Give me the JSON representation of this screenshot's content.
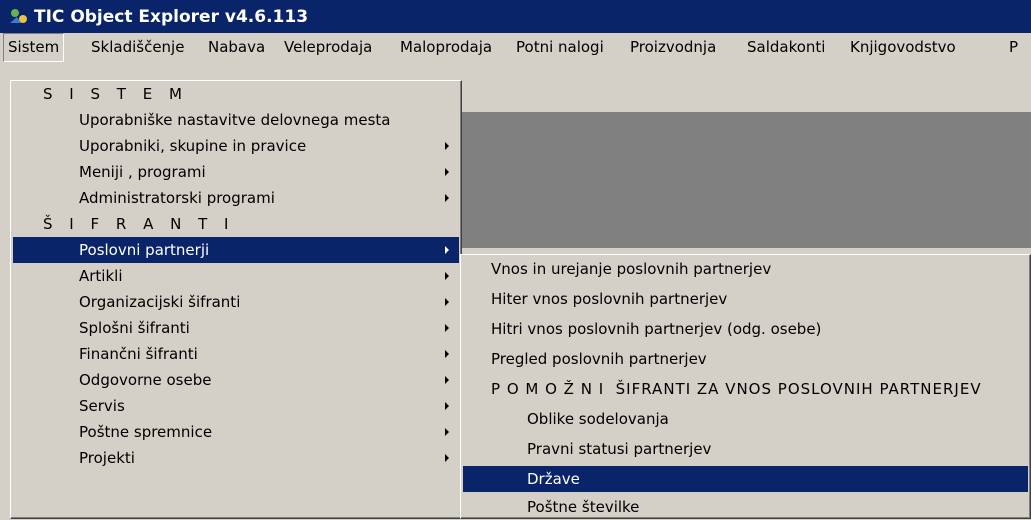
{
  "window": {
    "title": "TIC Object Explorer v4.6.113"
  },
  "menubar": [
    "Sistem",
    "Skladiščenje",
    "Nabava",
    "Veleprodaja",
    "Maloprodaja",
    "Potni nalogi",
    "Proizvodnja",
    "Saldakonti",
    "Knjigovodstvo",
    "P"
  ],
  "sistem_menu": {
    "header_sistem": "S I S T E M",
    "items_sistem": [
      "Uporabniške nastavitve delovnega mesta",
      "Uporabniki, skupine in pravice",
      "Meniji , programi",
      "Administratorski programi"
    ],
    "header_sifranti": "Š I F R A N T I",
    "items_sifranti": [
      "Poslovni partnerji",
      "Artikli",
      "Organizacijski šifranti",
      "Splošni šifranti",
      "Finančni šifranti",
      "Odgovorne osebe",
      "Servis",
      "Poštne spremnice",
      "Projekti"
    ]
  },
  "partner_submenu": {
    "items": [
      "Vnos in urejanje poslovnih partnerjev",
      "Hiter vnos poslovnih partnerjev",
      "Hitri vnos poslovnih partnerjev (odg. osebe)",
      "Pregled poslovnih partnerjev"
    ],
    "header": "P O M O Ž N I  ŠIFRANTI ZA VNOS POSLOVNIH PARTNERJEV",
    "sub_items": [
      "Oblike sodelovanja",
      "Pravni statusi partnerjev",
      "Države",
      "Poštne številke"
    ]
  },
  "colors": {
    "highlight": "#0a246a",
    "face": "#d4d0c8",
    "dark": "#808080"
  }
}
